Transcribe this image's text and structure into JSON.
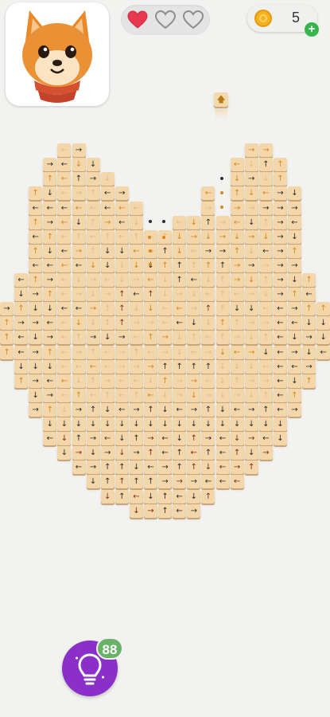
{
  "header": {
    "avatar_icon": "fox-avatar",
    "lives": {
      "filled": 1,
      "total": 3,
      "filled_color": "#e8384f",
      "empty_color": "#9a9a9a"
    },
    "coins": {
      "icon": "coin-icon",
      "count": "5",
      "add_label": "+"
    }
  },
  "hint": {
    "icon": "lightbulb-icon",
    "count": "88"
  },
  "board": {
    "shape": "fox-head",
    "tile_color": "#f3d7aa",
    "arrow_colors": {
      "black": "#2c2c2c",
      "orange": "#d9861e",
      "brown": "#7a2c1c",
      "pale": "#e0b98a"
    },
    "picked_tile": {
      "arrow": "up",
      "color": "#b57915"
    }
  }
}
